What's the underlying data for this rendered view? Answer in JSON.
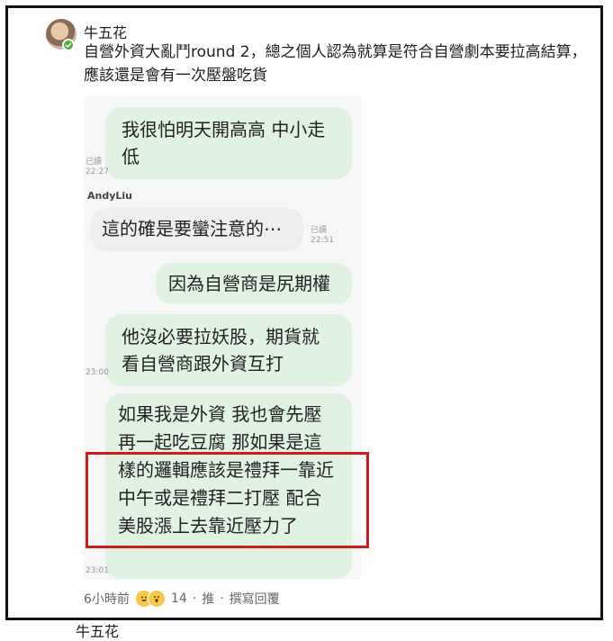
{
  "comment": {
    "author": "牛五花",
    "text": "自營外資大亂鬥round 2，總之個人認為就算是符合自營劇本要拉高結算，應該還是會有一次壓盤吃貨",
    "timestamp": "6小時前",
    "reaction_count": "14",
    "separator": "·",
    "like_label": "推",
    "reply_label": "撰寫回覆"
  },
  "chat_image": {
    "messages": [
      {
        "text": "我很怕明天開高高 中小走低",
        "side": "right",
        "read": "已讀",
        "time": "22:27"
      },
      {
        "sender": "AndyLiu",
        "text": "這的確是要蠻注意的⋯",
        "side": "left",
        "read": "已讀",
        "time": "22:51"
      },
      {
        "text": "因為自營商是尻期權",
        "side": "right"
      },
      {
        "text": "他沒必要拉妖股，期貨就看自營商跟外資互打",
        "side": "right",
        "time": "23:00"
      },
      {
        "text": "如果我是外資 我也會先壓再一起吃豆腐 那如果是這樣的邏輯應該是禮拜一靠近中午或是禮拜二打壓 配合美股漲上去靠近壓力了",
        "side": "right",
        "time": "23:01"
      }
    ]
  },
  "next_comment": {
    "author": "牛五花"
  },
  "colors": {
    "bubble_green": "#e0f3e2",
    "bubble_gray": "#eceef0",
    "highlight_red": "#d11a1a",
    "online_green": "#42b72a"
  },
  "icons": [
    "avatar",
    "online-status-icon",
    "haha-reaction-icon",
    "wow-reaction-icon"
  ]
}
